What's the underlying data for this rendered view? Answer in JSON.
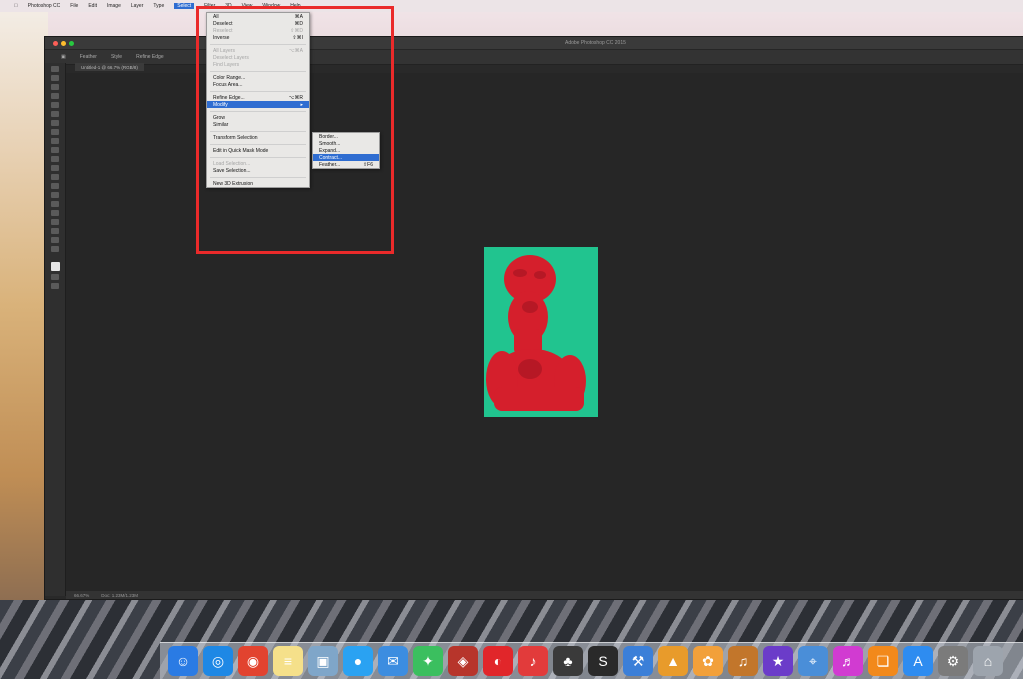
{
  "menubar": {
    "items": [
      "Photoshop CC",
      "File",
      "Edit",
      "Image",
      "Layer",
      "Type",
      "Select",
      "Filter",
      "3D",
      "View",
      "Window",
      "Help"
    ],
    "active": "Select"
  },
  "window": {
    "title": "Adobe Photoshop CC 2015",
    "options": [
      "Feather",
      "Style",
      "Refine Edge"
    ],
    "doc_tab": "Untitled-1 @ 66.7% (RGB/8)",
    "status": [
      "66.67%",
      "Doc: 1.23M/1.23M"
    ]
  },
  "select_menu": {
    "items": [
      {
        "label": "All",
        "shortcut": "⌘A",
        "state": "normal"
      },
      {
        "label": "Deselect",
        "shortcut": "⌘D",
        "state": "normal"
      },
      {
        "label": "Reselect",
        "shortcut": "⇧⌘D",
        "state": "disabled"
      },
      {
        "label": "Inverse",
        "shortcut": "⇧⌘I",
        "state": "normal"
      },
      {
        "sep": true
      },
      {
        "label": "All Layers",
        "shortcut": "⌥⌘A",
        "state": "disabled"
      },
      {
        "label": "Deselect Layers",
        "shortcut": "",
        "state": "disabled"
      },
      {
        "label": "Find Layers",
        "shortcut": "",
        "state": "disabled"
      },
      {
        "sep": true
      },
      {
        "label": "Color Range...",
        "shortcut": "",
        "state": "normal"
      },
      {
        "label": "Focus Area...",
        "shortcut": "",
        "state": "normal"
      },
      {
        "sep": true
      },
      {
        "label": "Refine Edge...",
        "shortcut": "⌥⌘R",
        "state": "normal"
      },
      {
        "label": "Modify",
        "shortcut": "▸",
        "state": "highlight"
      },
      {
        "sep": true
      },
      {
        "label": "Grow",
        "shortcut": "",
        "state": "normal"
      },
      {
        "label": "Similar",
        "shortcut": "",
        "state": "normal"
      },
      {
        "sep": true
      },
      {
        "label": "Transform Selection",
        "shortcut": "",
        "state": "normal"
      },
      {
        "sep": true
      },
      {
        "label": "Edit in Quick Mask Mode",
        "shortcut": "",
        "state": "normal"
      },
      {
        "sep": true
      },
      {
        "label": "Load Selection...",
        "shortcut": "",
        "state": "disabled"
      },
      {
        "label": "Save Selection...",
        "shortcut": "",
        "state": "normal"
      },
      {
        "sep": true
      },
      {
        "label": "New 3D Extrusion",
        "shortcut": "",
        "state": "normal"
      }
    ]
  },
  "modify_submenu": {
    "items": [
      {
        "label": "Border...",
        "shortcut": "",
        "state": "normal"
      },
      {
        "label": "Smooth...",
        "shortcut": "",
        "state": "normal"
      },
      {
        "label": "Expand...",
        "shortcut": "",
        "state": "normal"
      },
      {
        "label": "Contract...",
        "shortcut": "",
        "state": "highlight"
      },
      {
        "label": "Feather...",
        "shortcut": "⇧F6",
        "state": "normal"
      }
    ]
  },
  "dock": {
    "icons": [
      {
        "name": "finder-icon",
        "color": "#2a7be4",
        "glyph": "☺"
      },
      {
        "name": "safari-icon",
        "color": "#1e88e5",
        "glyph": "◎"
      },
      {
        "name": "chrome-icon",
        "color": "#e2432f",
        "glyph": "◉"
      },
      {
        "name": "notes-icon",
        "color": "#f5e08a",
        "glyph": "≡"
      },
      {
        "name": "preview-icon",
        "color": "#7fa6c9",
        "glyph": "▣"
      },
      {
        "name": "qq-icon",
        "color": "#2aa2f2",
        "glyph": "●"
      },
      {
        "name": "mail-icon",
        "color": "#3c8de0",
        "glyph": "✉"
      },
      {
        "name": "wechat-icon",
        "color": "#3bbf5f",
        "glyph": "✦"
      },
      {
        "name": "photo-booth-icon",
        "color": "#b7352b",
        "glyph": "◈"
      },
      {
        "name": "netease-icon",
        "color": "#e1262a",
        "glyph": "◐"
      },
      {
        "name": "music-app-icon",
        "color": "#e23b3b",
        "glyph": "♪"
      },
      {
        "name": "figure-app-icon",
        "color": "#3a3a3a",
        "glyph": "♣"
      },
      {
        "name": "editor-app-icon",
        "color": "#2a2a2a",
        "glyph": "S"
      },
      {
        "name": "xcode-icon",
        "color": "#3b7fd8",
        "glyph": "⚒"
      },
      {
        "name": "keynote-icon",
        "color": "#e89b2b",
        "glyph": "▲"
      },
      {
        "name": "photos-icon",
        "color": "#f2a03a",
        "glyph": "✿"
      },
      {
        "name": "guitar-icon",
        "color": "#c2762b",
        "glyph": "♫"
      },
      {
        "name": "imovie-icon",
        "color": "#6b3cc9",
        "glyph": "★"
      },
      {
        "name": "maps-icon",
        "color": "#4a8ed8",
        "glyph": "⌖"
      },
      {
        "name": "itunes-icon",
        "color": "#d13bd1",
        "glyph": "♬"
      },
      {
        "name": "ibooks-icon",
        "color": "#f2891b",
        "glyph": "❏"
      },
      {
        "name": "app-store-icon",
        "color": "#2e8cf0",
        "glyph": "A"
      },
      {
        "name": "system-preferences-icon",
        "color": "#7b7b7b",
        "glyph": "⚙"
      },
      {
        "name": "utility-icon",
        "color": "#9da4ad",
        "glyph": "⌂"
      }
    ]
  },
  "colors": {
    "accent": "#2f6dd1",
    "annotation": "#ea2a2a",
    "doc_background": "#21c48f",
    "figure": "#d51f2c"
  }
}
